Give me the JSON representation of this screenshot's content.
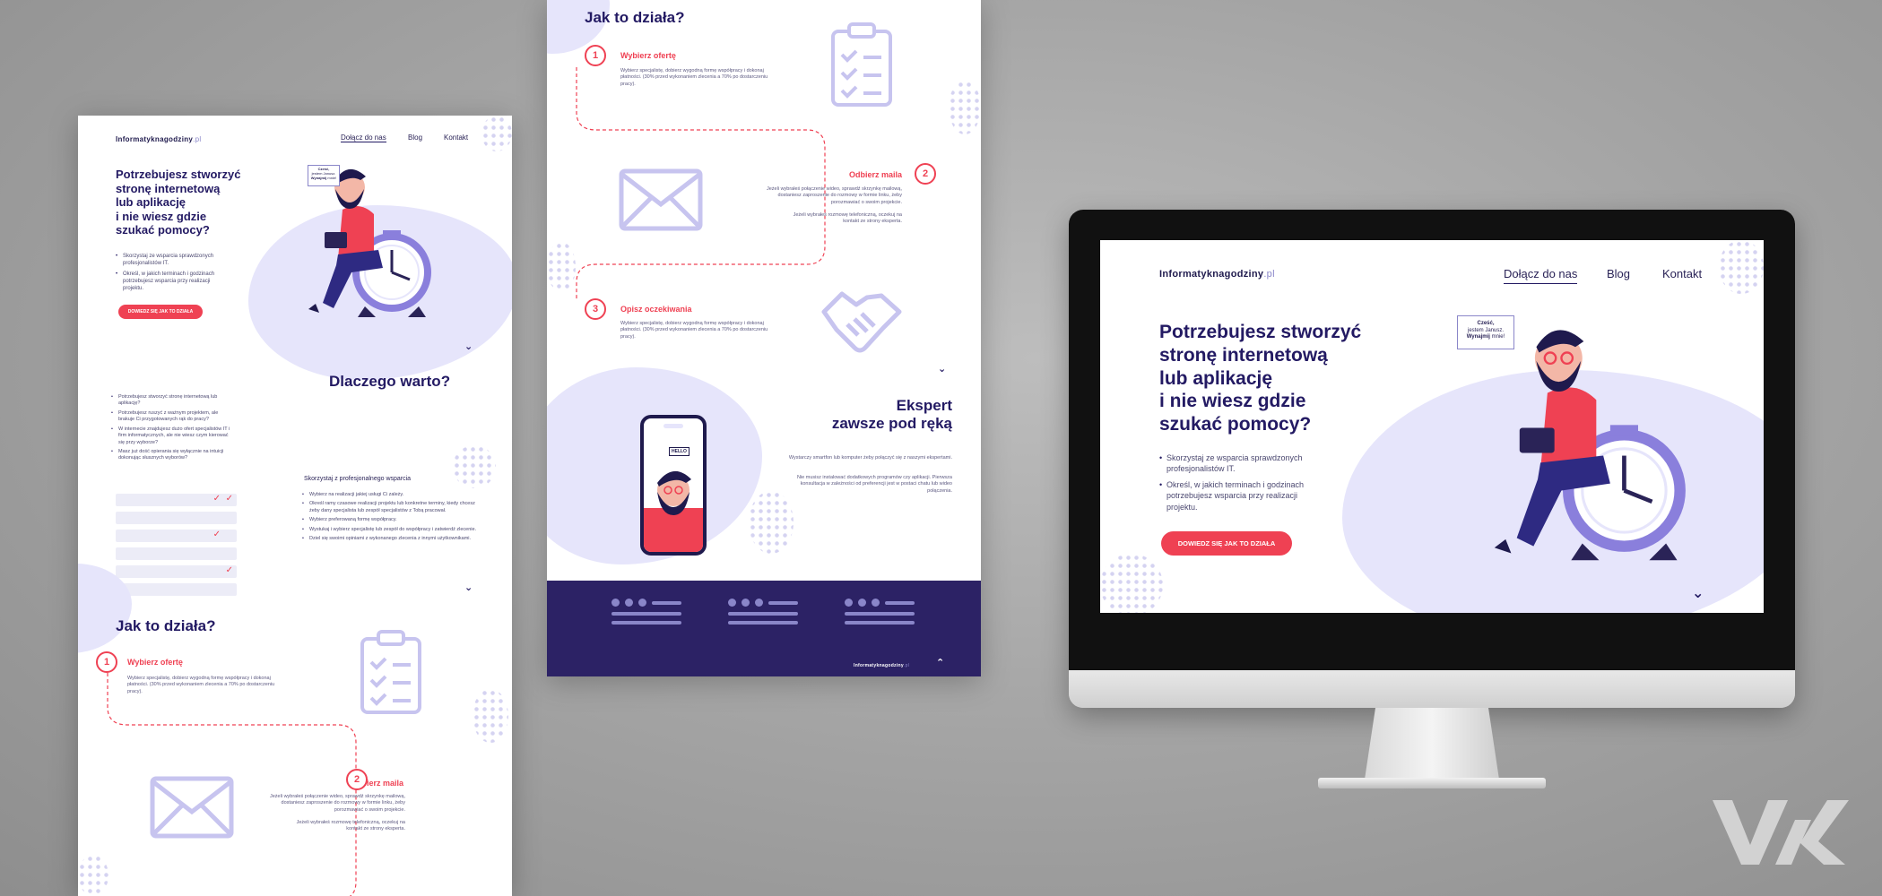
{
  "brand": {
    "name": "Informatyknagodziny",
    "tld": ".pl"
  },
  "nav": {
    "join": "Dołącz do nas",
    "blog": "Blog",
    "contact": "Kontakt"
  },
  "hero": {
    "title": "Potrzebujesz stworzyć stronę internetową lub aplikację i nie wiesz gdzie szukać pomocy?",
    "title_lines": [
      "Potrzebujesz stworzyć",
      "stronę internetową",
      "lub aplikację",
      "i nie wiesz gdzie",
      "szukać pomocy?"
    ],
    "bullet_1": "Skorzystaj ze wsparcia sprawdzonych profesjonalistów IT.",
    "bullet_2": "Określ, w jakich terminach i godzinach potrzebujesz wsparcia przy realizacji projektu.",
    "button": "DOWIEDZ SIĘ JAK TO DZIAŁA",
    "bubble_greeting": "Cześć,",
    "bubble_name": "jestem Janusz.",
    "bubble_hire": "Wynajmij",
    "bubble_me": "mnie!"
  },
  "why": {
    "title": "Dlaczego warto?",
    "items": [
      "Potrzebujesz stworzyć stronę internetową lub aplikację?",
      "Potrzebujesz ruszyć z ważnym projektem, ale brakuje Ci przygotowanych rąk do pracy?",
      "W internecie znajdujesz dużo ofert specjalistów IT i firm informatycznych, ale nie wiesz czym kierować się przy wyborze?",
      "Masz już dość opierania się wyłącznie na intuicji dokonując słusznych wyborów?"
    ],
    "pro_title": "Skorzystaj z profesjonalnego wsparcia",
    "pro_items": [
      "Wybierz na realizacji jakiej usługi Ci zależy.",
      "Określ ramy czasowe realizacji projektu lub konkretne terminy, kiedy chcesz żeby dany specjalista lub zespół specjalistów z Tobą pracował.",
      "Wybierz preferowaną formę współpracy.",
      "Wystukaj i wybierz specjalistę lub zespół do współpracy i zatwierdź zlecenie.",
      "Dziel się swoimi opiniami z wykonanego zlecenia z innymi użytkownikami."
    ]
  },
  "how": {
    "title": "Jak to działa?",
    "steps": [
      {
        "num": "1",
        "title": "Wybierz ofertę",
        "text": "Wybierz specjalistę, dobierz wygodną formę współpracy i dokonaj płatności. (30% przed wykonaniem zlecenia a 70% po dostarczeniu pracy)."
      },
      {
        "num": "2",
        "title": "Odbierz maila",
        "text": "Jeżeli wybrałeś połączenie wideo, sprawdź skrzynkę mailową, dostaniesz zaproszenie do rozmowy w formie linku, żeby porozmawiać o swoim projekcie.",
        "text2": "Jeżeli wybrałeś rozmowę telefoniczną, oczekuj na kontakt ze strony eksperta."
      },
      {
        "num": "3",
        "title": "Opisz oczekiwania",
        "text": "Wybierz specjalistę, dobierz wygodną formę współpracy i dokonaj płatności. (30% przed wykonaniem zlecenia a 70% po dostarczeniu pracy)."
      }
    ]
  },
  "expert": {
    "title_1": "Ekspert",
    "title_2": "zawsze pod ręką",
    "text_1": "Wystarczy smartfon lub komputer żeby połączyć się z naszymi ekspertami.",
    "text_2": "Nie musisz instalować dodatkowych programów czy aplikacji. Pierwsza konsultacja w zależności od preferencji jest w postaci chatu lub wideo połączenia.",
    "phone_hello": "HELLO"
  },
  "watermark": "VK",
  "colors": {
    "accent": "#ef4153",
    "brand_dark": "#231a63",
    "lavender": "#e6e5fb",
    "footer": "#2c2265"
  }
}
